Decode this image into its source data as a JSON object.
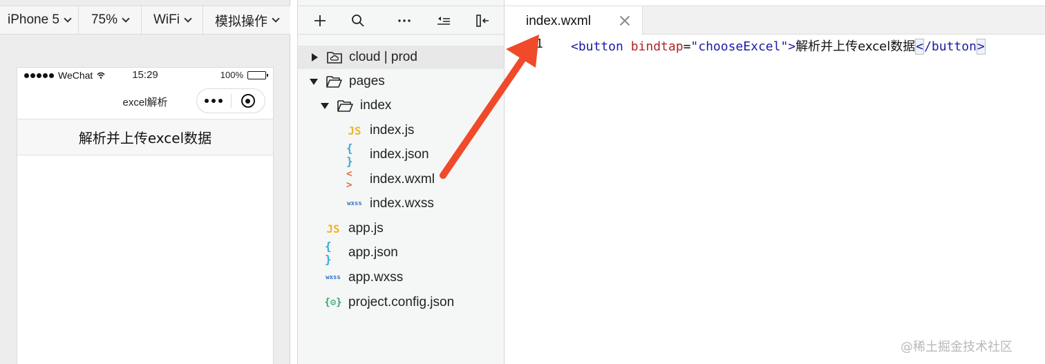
{
  "simulator": {
    "toolbar": {
      "device": "iPhone 5",
      "zoom": "75%",
      "network": "WiFi",
      "operation": "模拟操作"
    },
    "status_bar": {
      "carrier": "WeChat",
      "time": "15:29",
      "battery": "100%",
      "battery_level": 1.0
    },
    "nav_title": "excel解析",
    "page_button": "解析并上传excel数据"
  },
  "file_tree": {
    "toolbar_icons": [
      "plus-icon",
      "search-icon",
      "more-icon",
      "collapse-list-icon",
      "sidebar-toggle-icon"
    ],
    "items": [
      {
        "label": "cloud | prod",
        "icon": "cloud-folder-icon"
      },
      {
        "label": "pages",
        "icon": "folder-open-icon"
      },
      {
        "label": "index",
        "icon": "folder-open-icon"
      },
      {
        "label": "index.js",
        "icon": "js-file-icon",
        "glyph": "JS"
      },
      {
        "label": "index.json",
        "icon": "json-file-icon",
        "glyph": "{ }"
      },
      {
        "label": "index.wxml",
        "icon": "wxml-file-icon",
        "glyph": "< >"
      },
      {
        "label": "index.wxss",
        "icon": "wxss-file-icon",
        "glyph": "wxss"
      },
      {
        "label": "app.js",
        "icon": "js-file-icon",
        "glyph": "JS"
      },
      {
        "label": "app.json",
        "icon": "json-file-icon",
        "glyph": "{ }"
      },
      {
        "label": "app.wxss",
        "icon": "wxss-file-icon",
        "glyph": "wxss"
      },
      {
        "label": "project.config.json",
        "icon": "config-file-icon",
        "glyph": "{⚙}"
      }
    ]
  },
  "editor": {
    "tab_label": "index.wxml",
    "line_number": "1",
    "code": {
      "open_tag": "<button",
      "attr_name": " bindtap",
      "equals": "=",
      "attr_value": "\"chooseExcel\"",
      "open_close": ">",
      "text": "解析并上传excel数据",
      "close_lt": "<",
      "close_tag": "/button",
      "close_gt": ">"
    }
  },
  "watermark": "@稀土掘金技术社区",
  "colors": {
    "arrow": "#f04a2a",
    "js": "#f0b42a",
    "json": "#39a8d8",
    "wxml": "#e06d3a",
    "wxss": "#2a72c8",
    "config": "#2fa86f"
  }
}
